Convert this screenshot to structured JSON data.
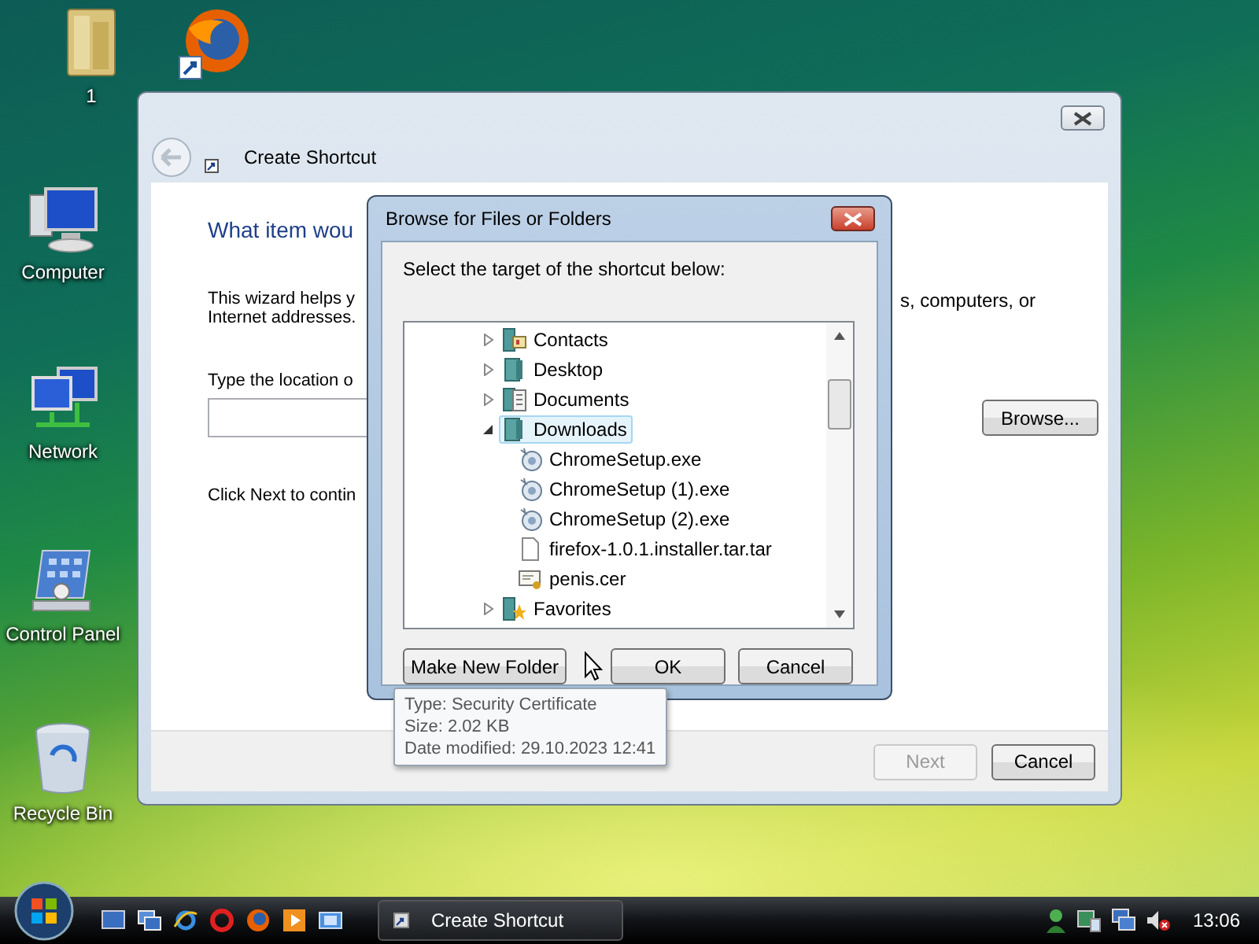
{
  "desktop_icons": [
    {
      "kind": "folder",
      "label": "1"
    },
    {
      "kind": "firefox"
    },
    {
      "kind": "computer",
      "label": "Computer"
    },
    {
      "kind": "network",
      "label": "Network"
    },
    {
      "kind": "control-panel",
      "label": "Control Panel"
    },
    {
      "kind": "recycle-bin",
      "label": "Recycle Bin"
    }
  ],
  "wizard": {
    "title": "Create Shortcut",
    "heading": "What item wou",
    "intro_left": [
      "This wizard helps y",
      "Internet addresses."
    ],
    "intro_right": "s, computers, or",
    "location_label": "Type the location o",
    "browse_button": "Browse...",
    "next_hint": "Click Next to contin",
    "buttons": [
      {
        "label": "Next",
        "disabled": true
      },
      {
        "label": "Cancel",
        "disabled": false
      }
    ]
  },
  "dialog": {
    "title": "Browse for Files or Folders",
    "prompt": "Select the target of the shortcut below:",
    "tree": [
      {
        "kind": "contacts",
        "label": "Contacts",
        "expanded": false,
        "selected": false
      },
      {
        "kind": "folder",
        "label": "Desktop",
        "expanded": false,
        "selected": false
      },
      {
        "kind": "documents",
        "label": "Documents",
        "expanded": false,
        "selected": false
      },
      {
        "kind": "folder",
        "label": "Downloads",
        "expanded": true,
        "selected": true,
        "children": [
          {
            "kind": "app",
            "label": "ChromeSetup.exe"
          },
          {
            "kind": "app",
            "label": "ChromeSetup (1).exe"
          },
          {
            "kind": "app",
            "label": "ChromeSetup (2).exe"
          },
          {
            "kind": "file",
            "label": "firefox-1.0.1.installer.tar.tar"
          },
          {
            "kind": "certificate",
            "label": "penis.cer"
          }
        ]
      },
      {
        "kind": "favorites",
        "label": "Favorites",
        "expanded": false,
        "selected": false
      }
    ],
    "buttons": [
      "Make New Folder",
      "OK",
      "Cancel"
    ],
    "tooltip": [
      "Type: Security Certificate",
      "Size: 2.02 KB",
      "Date modified: 29.10.2023 12:41"
    ]
  },
  "taskbar": {
    "task": "Create Shortcut",
    "clock": "13:06"
  }
}
